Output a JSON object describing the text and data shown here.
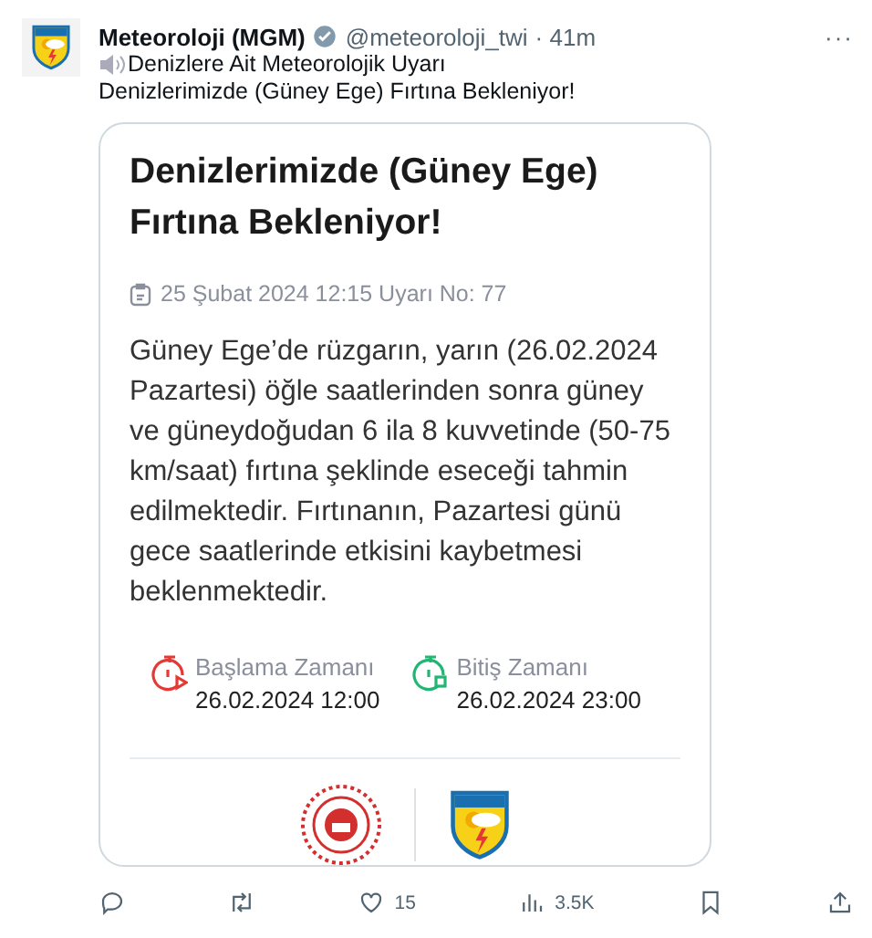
{
  "tweet": {
    "name": "Meteoroloji (MGM)",
    "verified": true,
    "handle": "@meteoroloji_twi",
    "time": "· 41m",
    "more": "···",
    "text_lines": [
      "Denizlere Ait Meteorolojik Uyarı",
      "Denizlerimizde (Güney Ege) Fırtına Bekleniyor!"
    ]
  },
  "card": {
    "title": "Denizlerimizde (Güney Ege) Fırtına Bekleniyor!",
    "meta": "25 Şubat 2024 12:15 Uyarı No: 77",
    "body": "Güney Ege’de rüzgarın,  yarın (26.02.2024 Pazartesi) öğle saatlerinden sonra güney ve güneydoğudan 6 ila 8 kuvvetinde (50-75 km/saat) fırtına şeklinde eseceği tahmin edilmektedir. Fırtınanın, Pazartesi günü gece saatlerinde etkisini kaybetmesi beklenmektedir.",
    "times": [
      {
        "kind": "start",
        "label": "Başlama Zamanı",
        "value": "26.02.2024 12:00",
        "color": "#e53935"
      },
      {
        "kind": "end",
        "label": "Bitiş Zamanı",
        "value": "26.02.2024 23:00",
        "color": "#22b573"
      }
    ]
  },
  "actions": [
    {
      "kind": "reply"
    },
    {
      "kind": "retweet"
    },
    {
      "kind": "like",
      "count": "15"
    },
    {
      "kind": "views",
      "count": "3.5K"
    },
    {
      "kind": "bookmark"
    },
    {
      "kind": "share"
    }
  ]
}
